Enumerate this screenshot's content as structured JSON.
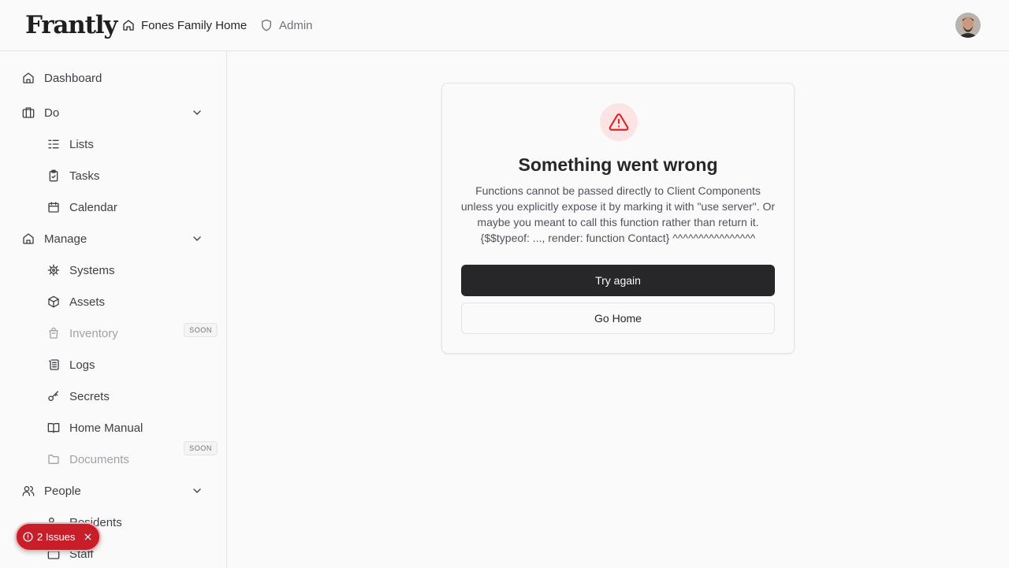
{
  "header": {
    "logo": "Frantly",
    "breadcrumb_home": "Fones Family Home",
    "breadcrumb_admin": "Admin",
    "avatar_icon": "user-avatar"
  },
  "sidebar": {
    "dashboard": "Dashboard",
    "do": "Do",
    "lists": "Lists",
    "tasks": "Tasks",
    "calendar": "Calendar",
    "manage": "Manage",
    "systems": "Systems",
    "assets": "Assets",
    "inventory": "Inventory",
    "inventory_badge": "SOON",
    "logs": "Logs",
    "secrets": "Secrets",
    "home_manual": "Home Manual",
    "documents": "Documents",
    "documents_badge": "SOON",
    "people": "People",
    "residents": "Residents",
    "staff": "Staff"
  },
  "error": {
    "title": "Something went wrong",
    "message": "Functions cannot be passed directly to Client Components unless you explicitly expose it by marking it with \"use server\". Or maybe you meant to call this function rather than return it. {$$typeof: ..., render: function Contact} ^^^^^^^^^^^^^^^^",
    "try_again": "Try again",
    "go_home": "Go Home"
  },
  "issues_toast": {
    "label": "2 Issues"
  },
  "colors": {
    "accent": "#27272a",
    "error_red": "#dc2626",
    "toast_red": "#c81e2a"
  }
}
